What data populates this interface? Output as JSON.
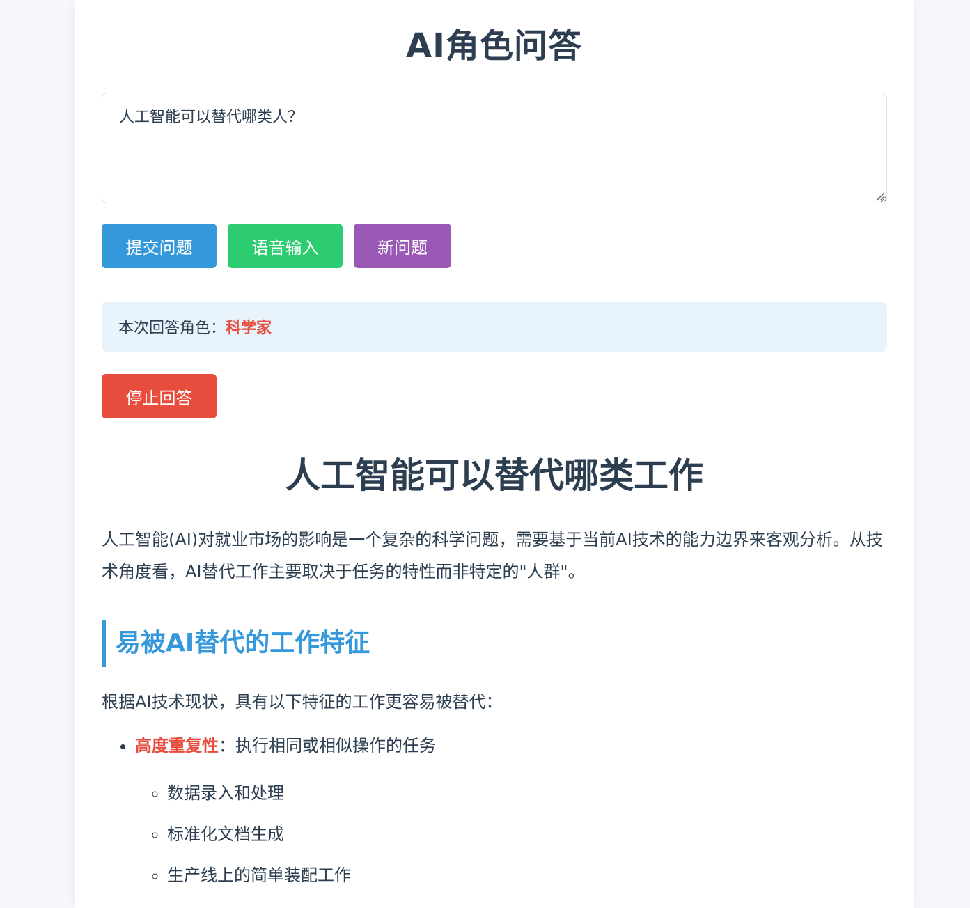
{
  "app": {
    "title": "AI角色问答"
  },
  "question": {
    "value": "人工智能可以替代哪类人？"
  },
  "buttons": {
    "submit": "提交问题",
    "voice": "语音输入",
    "new": "新问题",
    "stop": "停止回答"
  },
  "role": {
    "label": "本次回答角色：",
    "name": "科学家"
  },
  "answer": {
    "title": "人工智能可以替代哪类工作",
    "intro": "人工智能(AI)对就业市场的影响是一个复杂的科学问题，需要基于当前AI技术的能力边界来客观分析。从技术角度看，AI替代工作主要取决于任务的特性而非特定的\"人群\"。",
    "section_heading": "易被AI替代的工作特征",
    "section_lead": "根据AI技术现状，具有以下特征的工作更容易被替代：",
    "features": [
      {
        "name": "高度重复性",
        "desc": "：执行相同或相似操作的任务",
        "examples": [
          "数据录入和处理",
          "标准化文档生成",
          "生产线上的简单装配工作"
        ]
      }
    ]
  },
  "colors": {
    "submit": "#3498db",
    "voice": "#2ecc71",
    "new": "#9b59b6",
    "stop": "#e74c3c",
    "heading_accent": "#3498db",
    "highlight": "#e74c3c",
    "banner_bg": "#e8f3fc",
    "text": "#2c3e50"
  }
}
